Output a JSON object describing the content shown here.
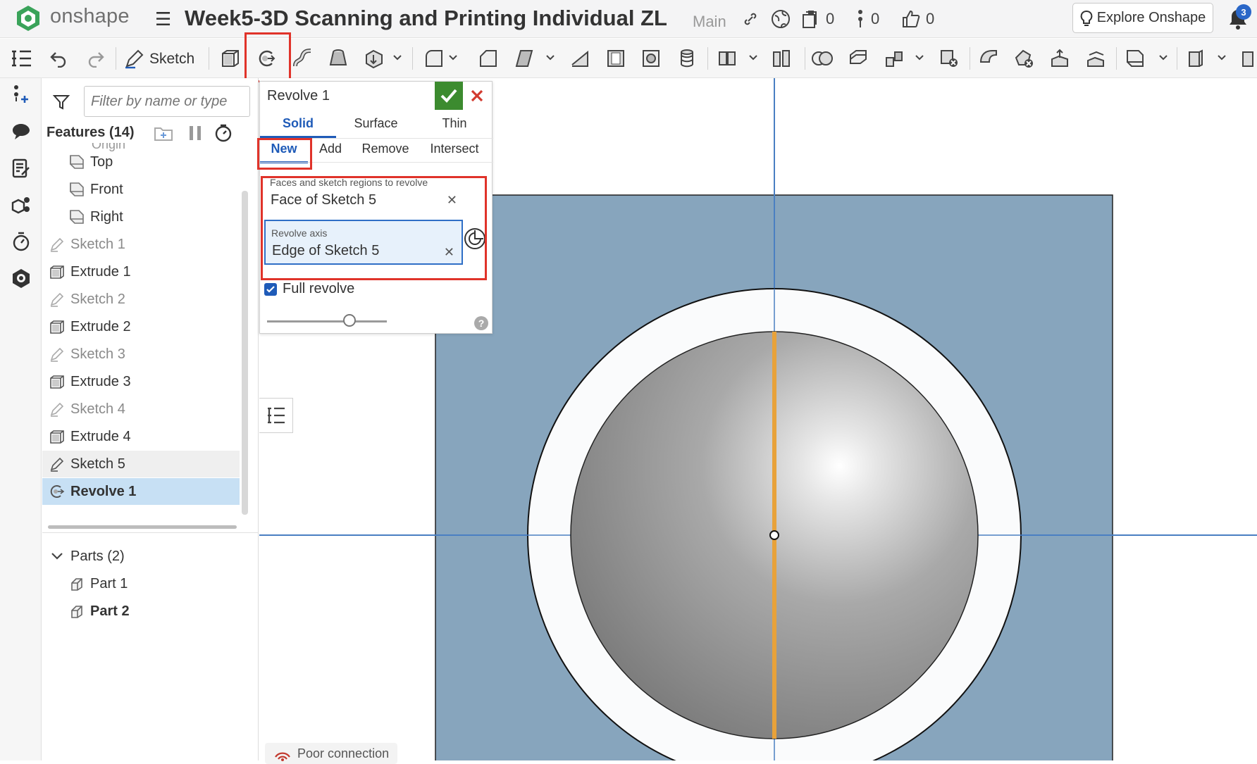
{
  "app": {
    "brand": "onshape",
    "doc_title": "Week5-3D Scanning and Printing Individual ZL",
    "branch": "Main"
  },
  "topbar": {
    "versions_count": "0",
    "branches_count": "0",
    "likes_count": "0",
    "explore_label": "Explore Onshape",
    "notifications": "3"
  },
  "toolbar": {
    "sketch_label": "Sketch"
  },
  "features": {
    "filter_placeholder": "Filter by name or type",
    "header": "Features (14)",
    "items": [
      {
        "label": "Top",
        "kind": "plane"
      },
      {
        "label": "Front",
        "kind": "plane"
      },
      {
        "label": "Right",
        "kind": "plane"
      },
      {
        "label": "Sketch 1",
        "kind": "sketch"
      },
      {
        "label": "Extrude 1",
        "kind": "extrude"
      },
      {
        "label": "Sketch 2",
        "kind": "sketch"
      },
      {
        "label": "Extrude 2",
        "kind": "extrude"
      },
      {
        "label": "Sketch 3",
        "kind": "sketch"
      },
      {
        "label": "Extrude 3",
        "kind": "extrude"
      },
      {
        "label": "Sketch 4",
        "kind": "sketch"
      },
      {
        "label": "Extrude 4",
        "kind": "extrude"
      },
      {
        "label": "Sketch 5",
        "kind": "sketch"
      },
      {
        "label": "Revolve 1",
        "kind": "revolve"
      }
    ],
    "parts_header": "Parts (2)",
    "parts": [
      {
        "label": "Part 1"
      },
      {
        "label": "Part 2"
      }
    ]
  },
  "dialog": {
    "title": "Revolve 1",
    "body_types": [
      "Solid",
      "Surface",
      "Thin"
    ],
    "active_body_type": "Solid",
    "operations": [
      "New",
      "Add",
      "Remove",
      "Intersect"
    ],
    "active_operation": "New",
    "faces_label": "Faces and sketch regions to revolve",
    "faces_value": "Face of Sketch 5",
    "axis_label": "Revolve axis",
    "axis_value": "Edge of Sketch 5",
    "full_revolve_label": "Full revolve",
    "full_revolve_checked": true
  },
  "status": {
    "connection": "Poor connection"
  },
  "colors": {
    "accent": "#1f5bb8",
    "highlight_box": "#e0332a",
    "confirm": "#3c8b2f",
    "plane": "#87a5bd",
    "axis": "#e8a23a",
    "selection": "#c7e0f4"
  }
}
